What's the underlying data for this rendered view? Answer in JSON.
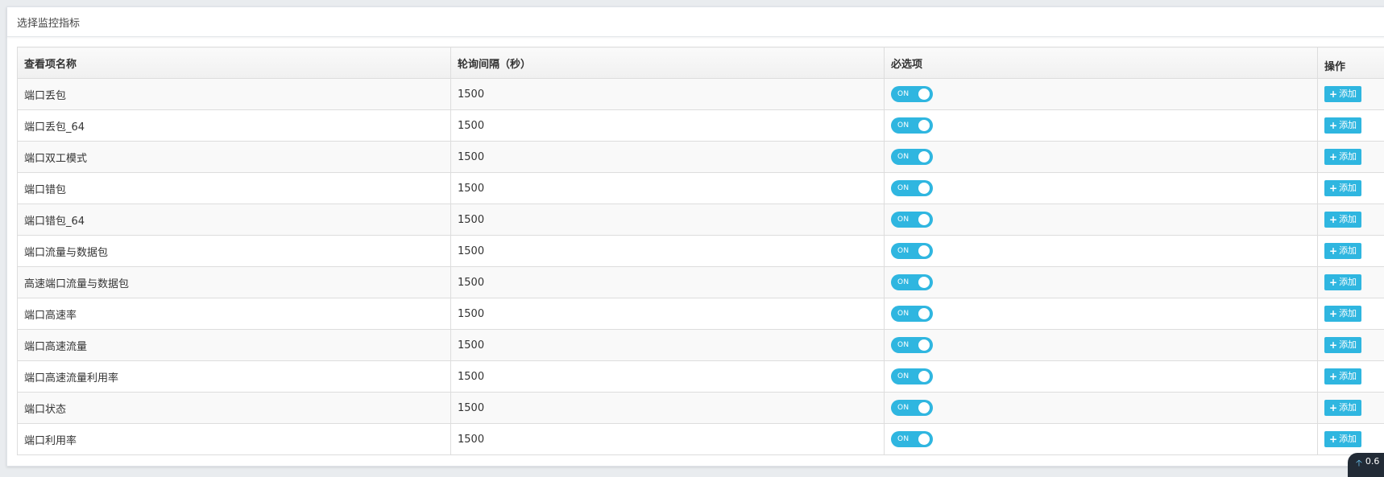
{
  "panel": {
    "title": "选择监控指标"
  },
  "table": {
    "headers": {
      "name": "查看项名称",
      "interval": "轮询间隔（秒）",
      "required": "必选项",
      "action": "操作"
    },
    "rows": [
      {
        "name": "端口丢包",
        "interval": "1500",
        "switch": "ON",
        "action": "添加"
      },
      {
        "name": "端口丢包_64",
        "interval": "1500",
        "switch": "ON",
        "action": "添加"
      },
      {
        "name": "端口双工模式",
        "interval": "1500",
        "switch": "ON",
        "action": "添加"
      },
      {
        "name": "端口错包",
        "interval": "1500",
        "switch": "ON",
        "action": "添加"
      },
      {
        "name": "端口错包_64",
        "interval": "1500",
        "switch": "ON",
        "action": "添加"
      },
      {
        "name": "端口流量与数据包",
        "interval": "1500",
        "switch": "ON",
        "action": "添加"
      },
      {
        "name": "高速端口流量与数据包",
        "interval": "1500",
        "switch": "ON",
        "action": "添加"
      },
      {
        "name": "端口高速率",
        "interval": "1500",
        "switch": "ON",
        "action": "添加"
      },
      {
        "name": "端口高速流量",
        "interval": "1500",
        "switch": "ON",
        "action": "添加"
      },
      {
        "name": "端口高速流量利用率",
        "interval": "1500",
        "switch": "ON",
        "action": "添加"
      },
      {
        "name": "端口状态",
        "interval": "1500",
        "switch": "ON",
        "action": "添加"
      },
      {
        "name": "端口利用率",
        "interval": "1500",
        "switch": "ON",
        "action": "添加"
      }
    ]
  },
  "badge": {
    "value": "0.6",
    "icon": "up-arrow-icon"
  },
  "colors": {
    "accent": "#2fb6e0",
    "badge_bg": "#222b36"
  }
}
